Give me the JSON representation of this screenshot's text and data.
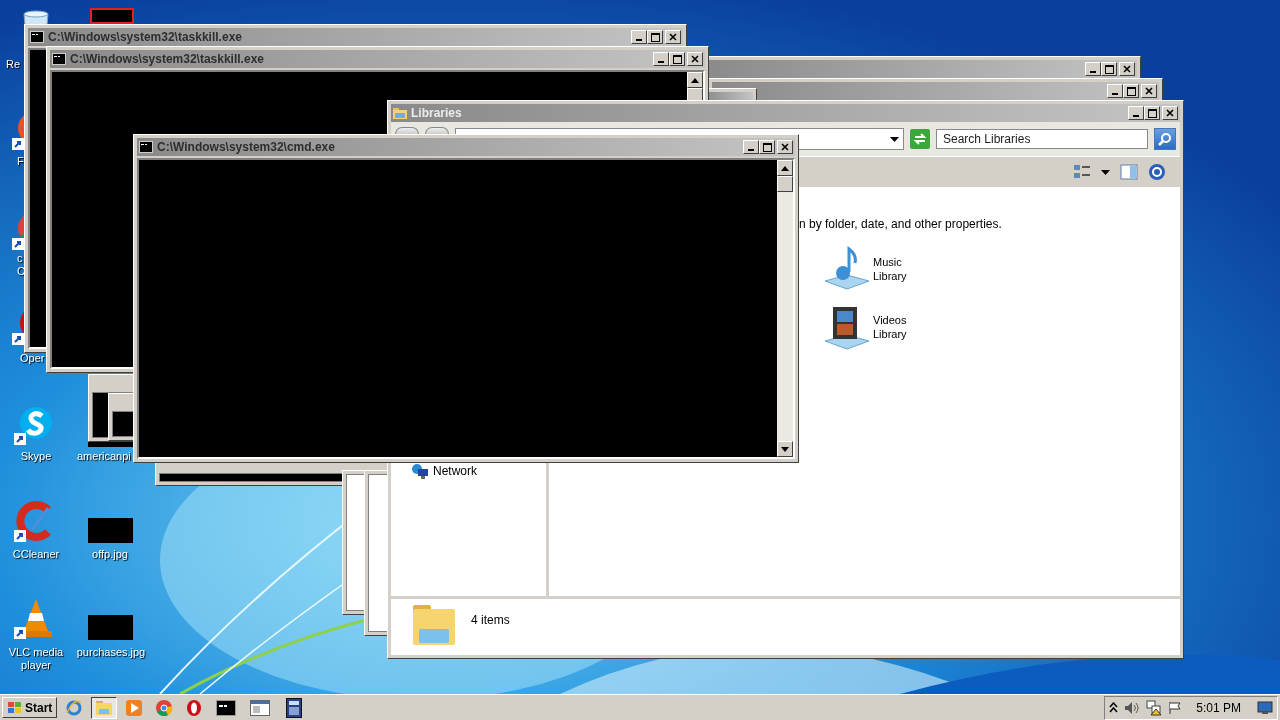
{
  "desktop_icons": [
    {
      "kind": "bin",
      "label": [
        "Re"
      ]
    },
    {
      "kind": "firefox",
      "label": [
        "F"
      ]
    },
    {
      "kind": "chrome",
      "label": [
        "c",
        "C"
      ]
    },
    {
      "kind": "opera",
      "label": [
        "Oper"
      ]
    },
    {
      "kind": "skype",
      "label": [
        "Skype"
      ]
    },
    {
      "kind": "ccleaner",
      "label": [
        "CCleaner"
      ]
    },
    {
      "kind": "vlc",
      "label": [
        "VLC media",
        "player"
      ]
    },
    {
      "kind": "framed-thumb"
    },
    {
      "kind": "thumb",
      "label": [
        "americanpi"
      ]
    },
    {
      "kind": "thumb",
      "label": [
        "offp.jpg"
      ]
    },
    {
      "kind": "thumb",
      "label": [
        "purchases.jpg"
      ]
    }
  ],
  "windows": [
    {
      "kind": "console",
      "title": "C:\\Windows\\system32\\taskkill.exe"
    },
    {
      "kind": "console",
      "title": "C:\\Windows\\system32\\taskkill.exe"
    },
    {
      "kind": "explorer",
      "title": "Libraries",
      "search": {
        "placeholder": "Search Libraries"
      },
      "intro": "n by folder, date, and other properties.",
      "libraries": [
        {
          "kind": "music",
          "label": [
            "Music",
            "Library"
          ]
        },
        {
          "kind": "videos",
          "label": [
            "Videos",
            "Library"
          ]
        }
      ],
      "nav": [
        {
          "kind": "network",
          "label": "Network"
        }
      ],
      "status": "4 items"
    },
    {
      "kind": "console",
      "title": "C:\\Windows\\system32\\cmd.exe"
    }
  ],
  "taskbar": {
    "start": "Start",
    "items": [
      {
        "kind": "ie",
        "selected": false
      },
      {
        "kind": "folder",
        "selected": true
      },
      {
        "kind": "media",
        "selected": false
      },
      {
        "kind": "chrome",
        "selected": false
      },
      {
        "kind": "opera",
        "selected": false
      },
      {
        "kind": "console",
        "selected": false
      },
      {
        "kind": "window",
        "selected": false
      },
      {
        "kind": "calculator",
        "selected": false
      }
    ],
    "tray": [
      {
        "kind": "arrow"
      },
      {
        "kind": "speaker"
      },
      {
        "kind": "network"
      },
      {
        "kind": "flag"
      }
    ],
    "clock": "5:01 PM"
  }
}
